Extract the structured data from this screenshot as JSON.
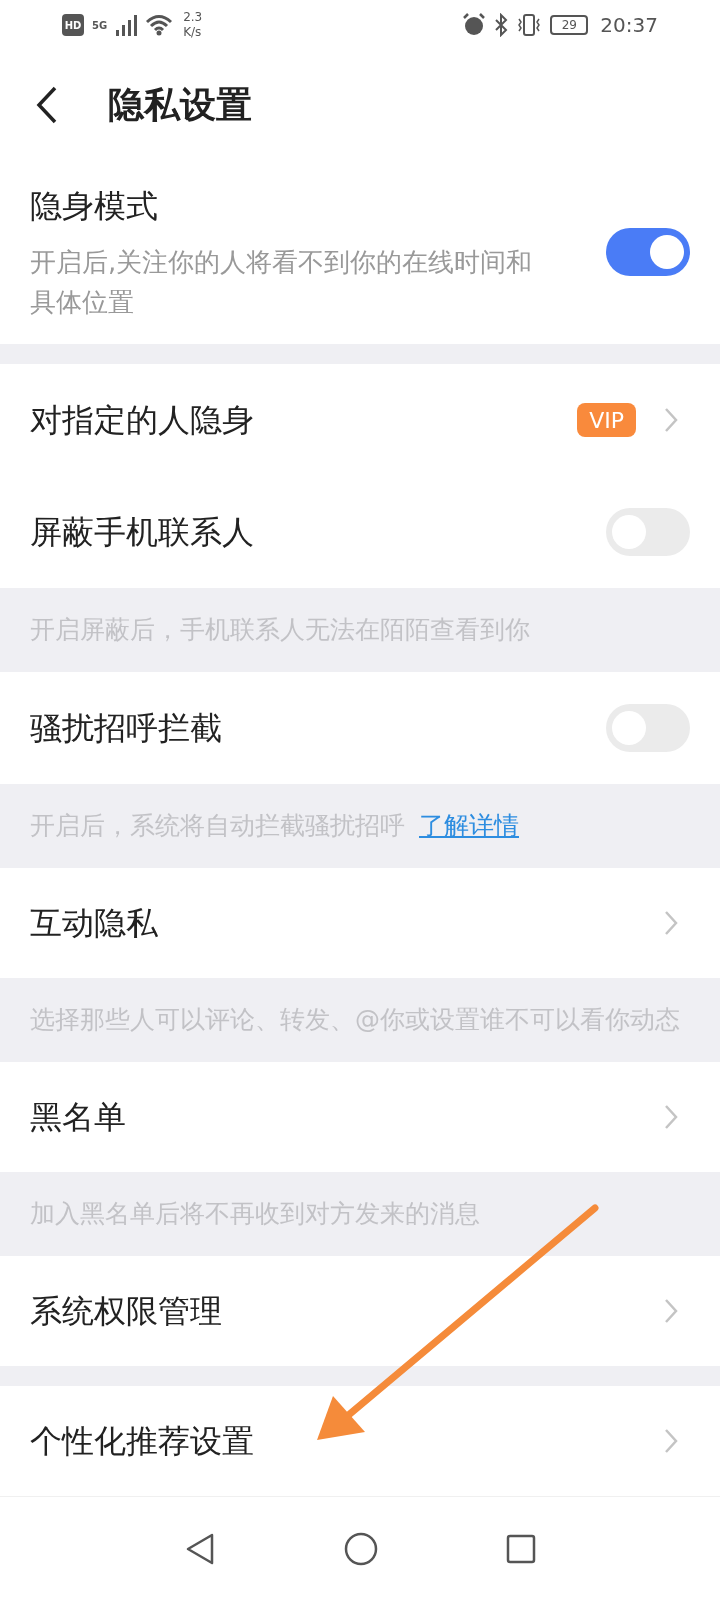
{
  "status_bar": {
    "hd": "HD",
    "network": "5G",
    "speed": "2.3",
    "speed_unit": "K/s",
    "battery": "29",
    "time": "20:37"
  },
  "header": {
    "title": "隐私设置"
  },
  "items": [
    {
      "kind": "toggle",
      "title": "隐身模式",
      "description": "开启后,关注你的人将看不到你的在线时间和具体位置",
      "on": true
    },
    {
      "kind": "gap"
    },
    {
      "kind": "vip",
      "title": "对指定的人隐身",
      "badge": "VIP"
    },
    {
      "kind": "toggle",
      "title": "屏蔽手机联系人",
      "on": false
    },
    {
      "kind": "note",
      "text": "开启屏蔽后，手机联系人无法在陌陌查看到你"
    },
    {
      "kind": "toggle",
      "title": "骚扰招呼拦截",
      "on": false
    },
    {
      "kind": "note",
      "text": "开启后，系统将自动拦截骚扰招呼",
      "link": "了解详情"
    },
    {
      "kind": "chevron",
      "title": "互动隐私"
    },
    {
      "kind": "note",
      "text": "选择那些人可以评论、转发、@你或设置谁不可以看你动态"
    },
    {
      "kind": "chevron",
      "title": "黑名单"
    },
    {
      "kind": "note",
      "text": "加入黑名单后将不再收到对方发来的消息"
    },
    {
      "kind": "chevron",
      "title": "系统权限管理"
    },
    {
      "kind": "gap"
    },
    {
      "kind": "chevron",
      "title": "个性化推荐设置"
    }
  ]
}
